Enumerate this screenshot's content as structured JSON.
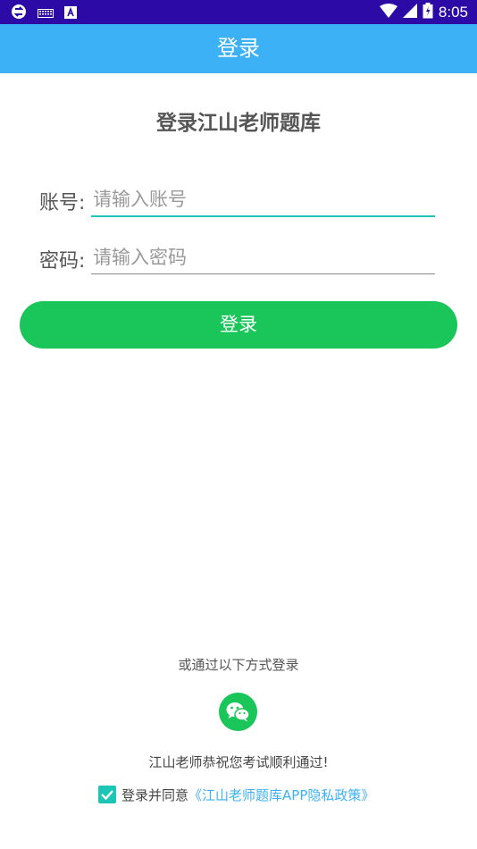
{
  "status_bar": {
    "time": "8:05",
    "icons": [
      "sync-icon",
      "keyboard-icon",
      "text-icon",
      "wifi-icon",
      "signal-icon",
      "battery-icon"
    ],
    "background": "#2c0aa6"
  },
  "app_bar": {
    "title": "登录",
    "background": "#3db1f5"
  },
  "page": {
    "heading": "登录江山老师题库"
  },
  "form": {
    "account_label": "账号:",
    "account_placeholder": "请输入账号",
    "account_value": "",
    "password_label": "密码:",
    "password_placeholder": "请输入密码",
    "password_value": "",
    "login_button": "登录",
    "button_color": "#1ac55a",
    "focus_color": "#1cc5b4"
  },
  "alt_login": {
    "text": "或通过以下方式登录",
    "wechat_icon": "wechat-icon"
  },
  "footer": {
    "wish": "江山老师恭祝您考试顺利通过!",
    "agree_text": "登录并同意",
    "policy_link": "《江山老师题库APP隐私政策》",
    "checked": true,
    "link_color": "#3db1f5"
  }
}
